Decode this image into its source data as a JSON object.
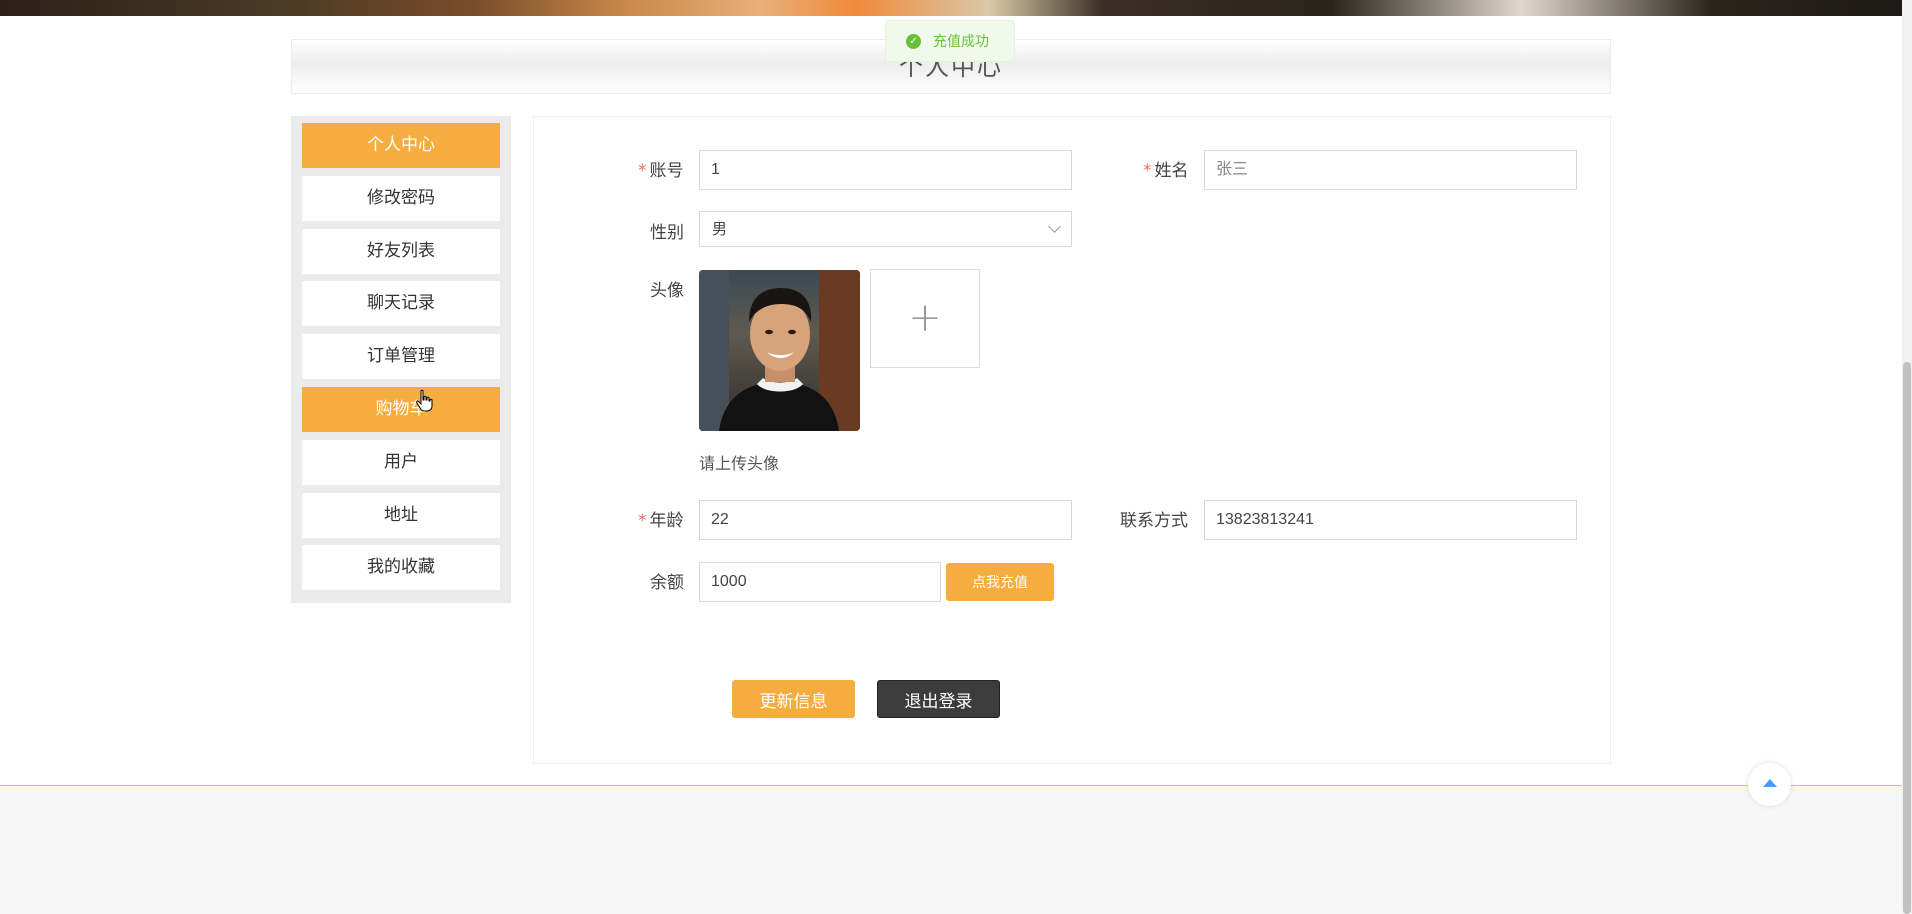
{
  "toast": {
    "message": "充值成功"
  },
  "header": {
    "title": "个人中心"
  },
  "sidebar": {
    "items": [
      {
        "label": "个人中心",
        "active": true
      },
      {
        "label": "修改密码",
        "active": false
      },
      {
        "label": "好友列表",
        "active": false
      },
      {
        "label": "聊天记录",
        "active": false
      },
      {
        "label": "订单管理",
        "active": false
      },
      {
        "label": "购物车",
        "active": true
      },
      {
        "label": "用户",
        "active": false
      },
      {
        "label": "地址",
        "active": false
      },
      {
        "label": "我的收藏",
        "active": false
      }
    ]
  },
  "form": {
    "account": {
      "label": "账号",
      "required": "*",
      "value": "1"
    },
    "name": {
      "label": "姓名",
      "required": "*",
      "value": "张三"
    },
    "gender": {
      "label": "性别",
      "value": "男"
    },
    "avatar": {
      "label": "头像",
      "hint": "请上传头像"
    },
    "age": {
      "label": "年龄",
      "required": "*",
      "value": "22"
    },
    "contact": {
      "label": "联系方式",
      "value": "13823813241"
    },
    "balance": {
      "label": "余额",
      "value": "1000",
      "recharge_label": "点我充值"
    }
  },
  "actions": {
    "update_label": "更新信息",
    "logout_label": "退出登录"
  },
  "colors": {
    "accent": "#f5ad40",
    "dark": "#3c3c3c",
    "success": "#67c23a",
    "required": "#f56c6c"
  },
  "icons": {
    "toast": "check-circle-icon",
    "upload": "plus-icon",
    "back_to_top": "caret-up-icon",
    "select": "chevron-down-icon"
  }
}
